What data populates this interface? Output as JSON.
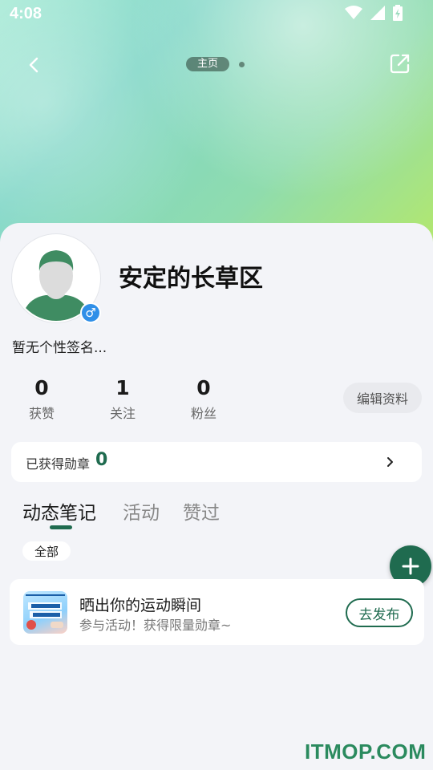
{
  "status_bar": {
    "time": "4:08"
  },
  "nav": {
    "page_label": "主页"
  },
  "profile": {
    "username": "安定的长草区",
    "signature": "暂无个性签名...",
    "gender_symbol": "♂"
  },
  "stats": [
    {
      "value": "0",
      "label": "获赞"
    },
    {
      "value": "1",
      "label": "关注"
    },
    {
      "value": "0",
      "label": "粉丝"
    }
  ],
  "edit_button": "编辑资料",
  "badges": {
    "label": "已获得勋章",
    "count": "0"
  },
  "tabs": [
    {
      "label": "动态笔记",
      "active": true
    },
    {
      "label": "活动",
      "active": false
    },
    {
      "label": "赞过",
      "active": false
    }
  ],
  "filter": {
    "selected": "全部"
  },
  "promo": {
    "title": "晒出你的运动瞬间",
    "subtitle": "参与活动！获得限量勋章~",
    "button": "去发布"
  },
  "watermark": "ITMOP.COM",
  "colors": {
    "accent": "#1f6b4f",
    "gender": "#2f8fe8"
  }
}
